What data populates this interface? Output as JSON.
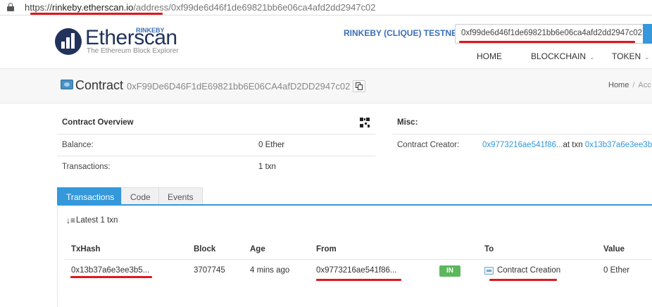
{
  "browser": {
    "url_scheme": "https://",
    "url_host": "rinkeby.etherscan.io",
    "url_path": "/address/0xf99de6d46f1de69821bb6e06ca4afd2dd2947c02"
  },
  "header": {
    "logo_text": "Etherscan",
    "logo_badge": "RINKEBY",
    "logo_tagline": "The Ethereum Block Explorer",
    "network_label": "RINKEBY (CLIQUE) TESTNET",
    "search_value": "0xf99de6d46f1de69821bb6e06ca4afd2dd2947c02",
    "nav": [
      {
        "label": "HOME"
      },
      {
        "label": "BLOCKCHAIN"
      },
      {
        "label": "TOKEN"
      }
    ]
  },
  "title_bar": {
    "title": "Contract",
    "address": "0xF99De6D46F1dE69821bb6E06CA4afD2DD2947c02",
    "breadcrumb_home": "Home",
    "breadcrumb_next": "Acc"
  },
  "overview": {
    "heading": "Contract Overview",
    "balance_label": "Balance:",
    "balance_value": "0 Ether",
    "tx_label": "Transactions:",
    "tx_value": "1 txn"
  },
  "misc": {
    "heading": "Misc:",
    "creator_label": "Contract Creator:",
    "creator_address": "0x9773216ae541f86...",
    "at_txn_text": "at txn",
    "creator_txn": "0x13b37a6e3ee3b5..."
  },
  "tabs": [
    {
      "label": "Transactions",
      "active": true
    },
    {
      "label": "Code",
      "active": false
    },
    {
      "label": "Events",
      "active": false
    }
  ],
  "transactions": {
    "summary": "Latest 1 txn",
    "columns": [
      "TxHash",
      "Block",
      "Age",
      "From",
      "To",
      "Value"
    ],
    "rows": [
      {
        "txhash": "0x13b37a6e3ee3b5...",
        "block": "3707745",
        "age": "4 mins ago",
        "from": "0x9773216ae541f86...",
        "direction": "IN",
        "to": "Contract Creation",
        "value": "0 Ether"
      }
    ]
  },
  "colors": {
    "accent": "#3498db",
    "brand_navy": "#21325b",
    "in_badge": "#5cb85c",
    "annotation_red": "#e0181e"
  }
}
